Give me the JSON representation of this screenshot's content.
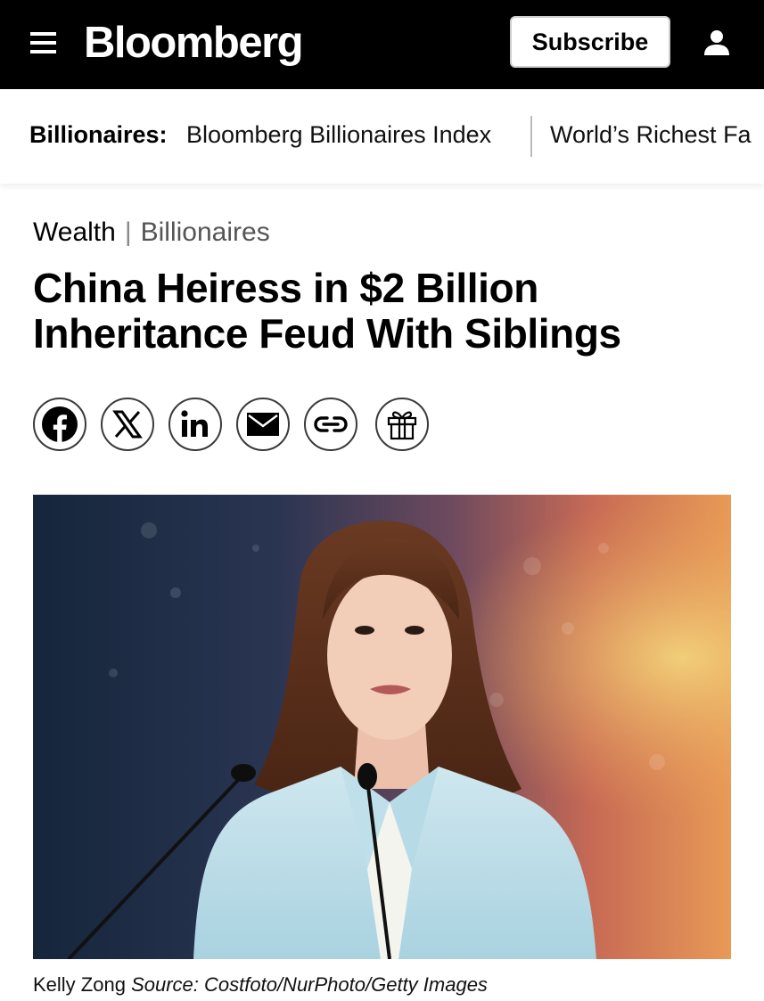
{
  "header": {
    "brand": "Bloomberg",
    "subscribe_label": "Subscribe",
    "icons": [
      "menu-icon",
      "user-icon"
    ],
    "background_color": "#000000"
  },
  "subnav": {
    "label": "Billionaires:",
    "links": [
      "Bloomberg Billionaires Index",
      "World’s Richest Fa"
    ]
  },
  "article": {
    "category_primary": "Wealth",
    "category_secondary": "Billionaires",
    "headline_line1": "China Heiress in $2 Billion",
    "headline_line2": "Inheritance Feud With Siblings",
    "share_icons": [
      "facebook-icon",
      "x-icon",
      "linkedin-icon",
      "email-icon",
      "link-icon",
      "gift-icon"
    ],
    "caption_name": "Kelly Zong",
    "caption_source": "Source: Costfoto/NurPhoto/Getty Images"
  }
}
